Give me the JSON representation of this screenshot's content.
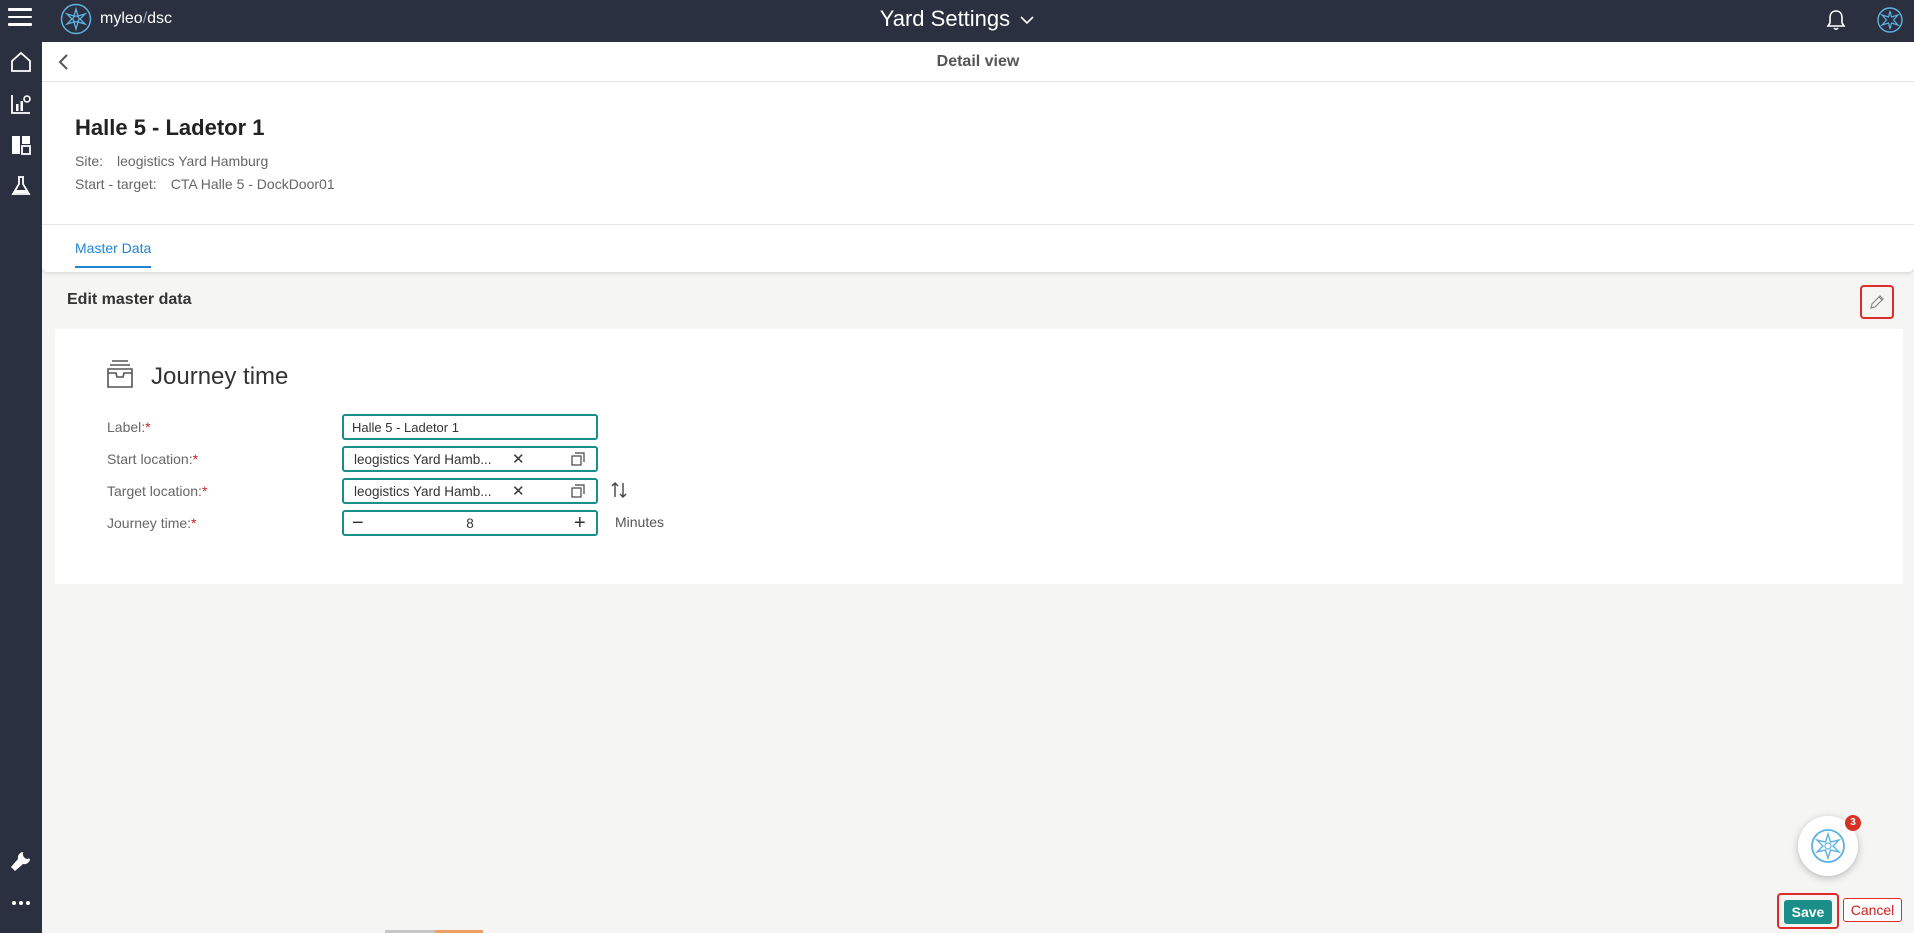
{
  "app": {
    "logo_name": "myleo",
    "logo_slash": "/",
    "logo_suffix": "dsc",
    "title": "Yard Settings"
  },
  "sidebar": {
    "items": [
      {
        "icon": "home-icon"
      },
      {
        "icon": "analytics-icon"
      },
      {
        "icon": "dashboard-icon"
      },
      {
        "icon": "lab-flask-icon"
      },
      {
        "icon": "wrench-icon"
      },
      {
        "icon": "more-icon"
      }
    ]
  },
  "detail": {
    "header_title": "Detail view",
    "record_title": "Halle 5 - Ladetor 1",
    "site_label": "Site:",
    "site_value": "leogistics Yard Hamburg",
    "start_target_label": "Start - target:",
    "start_target_value": "CTA Halle 5 - DockDoor01"
  },
  "tabs": {
    "master_data": "Master Data"
  },
  "edit": {
    "title": "Edit master data"
  },
  "form": {
    "section_title": "Journey time",
    "label_field": {
      "label": "Label:",
      "required": "*",
      "value": "Halle 5 - Ladetor 1"
    },
    "start_location": {
      "label": "Start location:",
      "required": "*",
      "value": "leogistics Yard Hamb...",
      "clear": "✕"
    },
    "target_location": {
      "label": "Target location:",
      "required": "*",
      "value": "leogistics Yard Hamb...",
      "clear": "✕"
    },
    "journey_time": {
      "label": "Journey time:",
      "required": "*",
      "value": "8",
      "minus": "−",
      "plus": "+",
      "unit": "Minutes"
    }
  },
  "assistant": {
    "badge_count": "3"
  },
  "actions": {
    "save": "Save",
    "cancel": "Cancel"
  },
  "colors": {
    "topbar": "#2b3040",
    "accent_teal": "#1a8f8a",
    "tab_blue": "#1f84d1",
    "required_red": "#d02020",
    "highlight_red": "#e02b2b"
  }
}
